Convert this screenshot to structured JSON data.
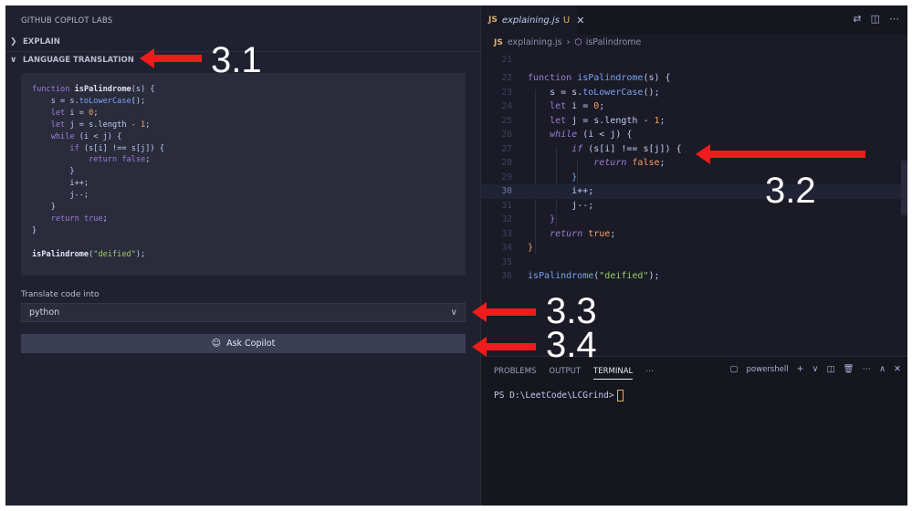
{
  "left_panel": {
    "title": "GITHUB COPILOT LABS",
    "sections": {
      "explain": "EXPLAIN",
      "language_translation": "LANGUAGE TRANSLATION"
    },
    "translate_label": "Translate code into",
    "language_select": {
      "value": "python"
    },
    "ask_button": "Ask Copilot"
  },
  "editor": {
    "tab": {
      "badge": "JS",
      "filename": "explaining.js",
      "modified": "U"
    },
    "breadcrumb": {
      "file": "explaining.js",
      "symbol": "isPalindrome"
    },
    "line_numbers": [
      "21",
      "22",
      "23",
      "24",
      "25",
      "26",
      "27",
      "28",
      "29",
      "30",
      "31",
      "32",
      "33",
      "34",
      "35",
      "36"
    ]
  },
  "terminal": {
    "tabs": [
      "PROBLEMS",
      "OUTPUT",
      "TERMINAL"
    ],
    "shell": "powershell",
    "prompt": "PS D:\\LeetCode\\LCGrind>"
  },
  "annotations": [
    "3.1",
    "3.2",
    "3.3",
    "3.4"
  ],
  "colors": {
    "arrow": "#ee1c1c",
    "keyword": "#9d7cd8",
    "function": "#7aa2f7",
    "number": "#ff9e64",
    "string": "#9ece6a"
  }
}
